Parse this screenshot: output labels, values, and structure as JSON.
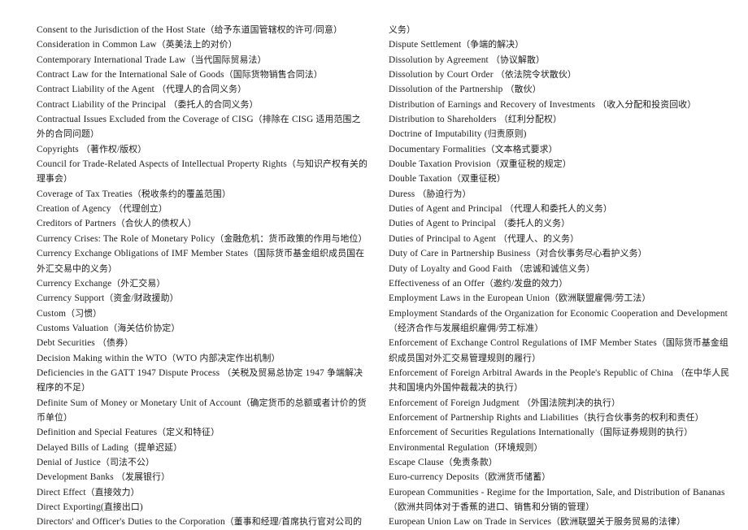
{
  "document": {
    "type": "bilingual-glossary",
    "language_pair": "English-Chinese",
    "columns": 2
  },
  "left_column": {
    "entries": [
      "Consent to the Jurisdiction of the Host State（给予东道国管辖权的许可/同意）",
      "Consideration in Common Law（英美法上的对价）",
      "Contemporary International Trade Law（当代国际贸易法）",
      "Contract Law for the International Sale of Goods（国际货物销售合同法）",
      "Contract Liability of the Agent （代理人的合同义务）",
      "Contract Liability of the Principal （委托人的合同义务）",
      "Contractual Issues Excluded from the Coverage of CISG（排除在 CISG 适用范围之外的合同问题）",
      "Copyrights （著作权/版权）",
      "Council for Trade-Related Aspects of Intellectual Property Rights（与知识产权有关的理事会）",
      "Coverage of Tax Treaties（税收条约的覆盖范围）",
      "Creation of Agency （代理创立）",
      "Creditors of Partners（合伙人的债权人）",
      "Currency Crises: The Role of Monetary Policy（金融危机：货币政策的作用与地位）",
      "Currency Exchange Obligations of IMF Member States（国际货币基金组织成员国在外汇交易中的义务）",
      "Currency Exchange（外汇交易）",
      "Currency Support（资金/财政援助）",
      "Custom（习惯）",
      "Customs Valuation（海关估价协定）",
      "Debt Securities （债券）",
      "Decision Making within the WTO（WTO 内部决定作出机制）",
      "Deficiencies in the GATT 1947 Dispute Process （关税及贸易总协定 1947 争端解决程序的不足）",
      "Definite Sum of Money or Monetary Unit of Account（确定货币的总额或者计价的货币单位）",
      "Definition and Special Features（定义和特征）",
      "Delayed Bills of Lading（提单迟延）",
      "Denial of Justice（司法不公）",
      "Development Banks （发展银行）",
      "Direct Effect（直接效力）",
      "Direct Exporting(直接出口)",
      "Directors' and Officer's Duties to the Corporation（董事和经理/首席执行官对公司的"
    ]
  },
  "right_column": {
    "entries": [
      "义务）",
      "Dispute Settlement（争端的解决）",
      "Dissolution by Agreement （协议解散）",
      "Dissolution by Court Order （依法院令状散伙）",
      "Dissolution of the Partnership （散伙）",
      "Distribution of Earnings and Recovery of Investments （收入分配和投资回收）",
      "Distribution to Shareholders （红利分配权）",
      "Doctrine of Imputability (归责原则)",
      "Documentary Formalities（文本格式要求）",
      "Double Taxation Provision（双重征税的规定）",
      "Double Taxation（双重征税）",
      "Duress （胁迫行为）",
      "Duties of Agent and Principal （代理人和委托人的义务）",
      "Duties of Agent to Principal （委托人的义务）",
      "Duties of Principal to Agent （代理人、的义务）",
      "Duty of Care in Partnership Business（对合伙事务尽心看护义务）",
      "Duty of Loyalty and Good Faith （忠诚和诚信义务）",
      "Effectiveness of an Offer（邀约/发盘的效力）",
      "Employment Laws in the European Union（欧洲联盟雇佣/劳工法）",
      "Employment Standards of the Organization for Economic Cooperation and Development（经济合作与发展组织雇佣/劳工标准）",
      "Enforcement of Exchange Control Regulations of IMF Member States（国际货币基金组织成员国对外汇交易管理规则的履行）",
      "Enforcement of Foreign Arbitral Awards in the People's Republic of China （在中华人民共和国境内外国仲裁裁决的执行）",
      "Enforcement of Foreign Judgment （外国法院判决的执行）",
      "Enforcement of Partnership Rights and Liabilities（执行合伙事务的权利和责任）",
      "Enforcement of Securities Regulations Internationally（国际证券规则的执行）",
      "Environmental Regulation（环境规则）",
      "Escape Clause（免责条款）",
      "Euro-currency Deposits（欧洲货币储蓄）",
      "European Communities - Regime for the Importation, Sale, and Distribution of Bananas（欧洲共同体对于香蕉的进口、销售和分销的管理）",
      "European Union Law on Trade in Services（欧洲联盟关于服务贸易的法律）"
    ]
  }
}
